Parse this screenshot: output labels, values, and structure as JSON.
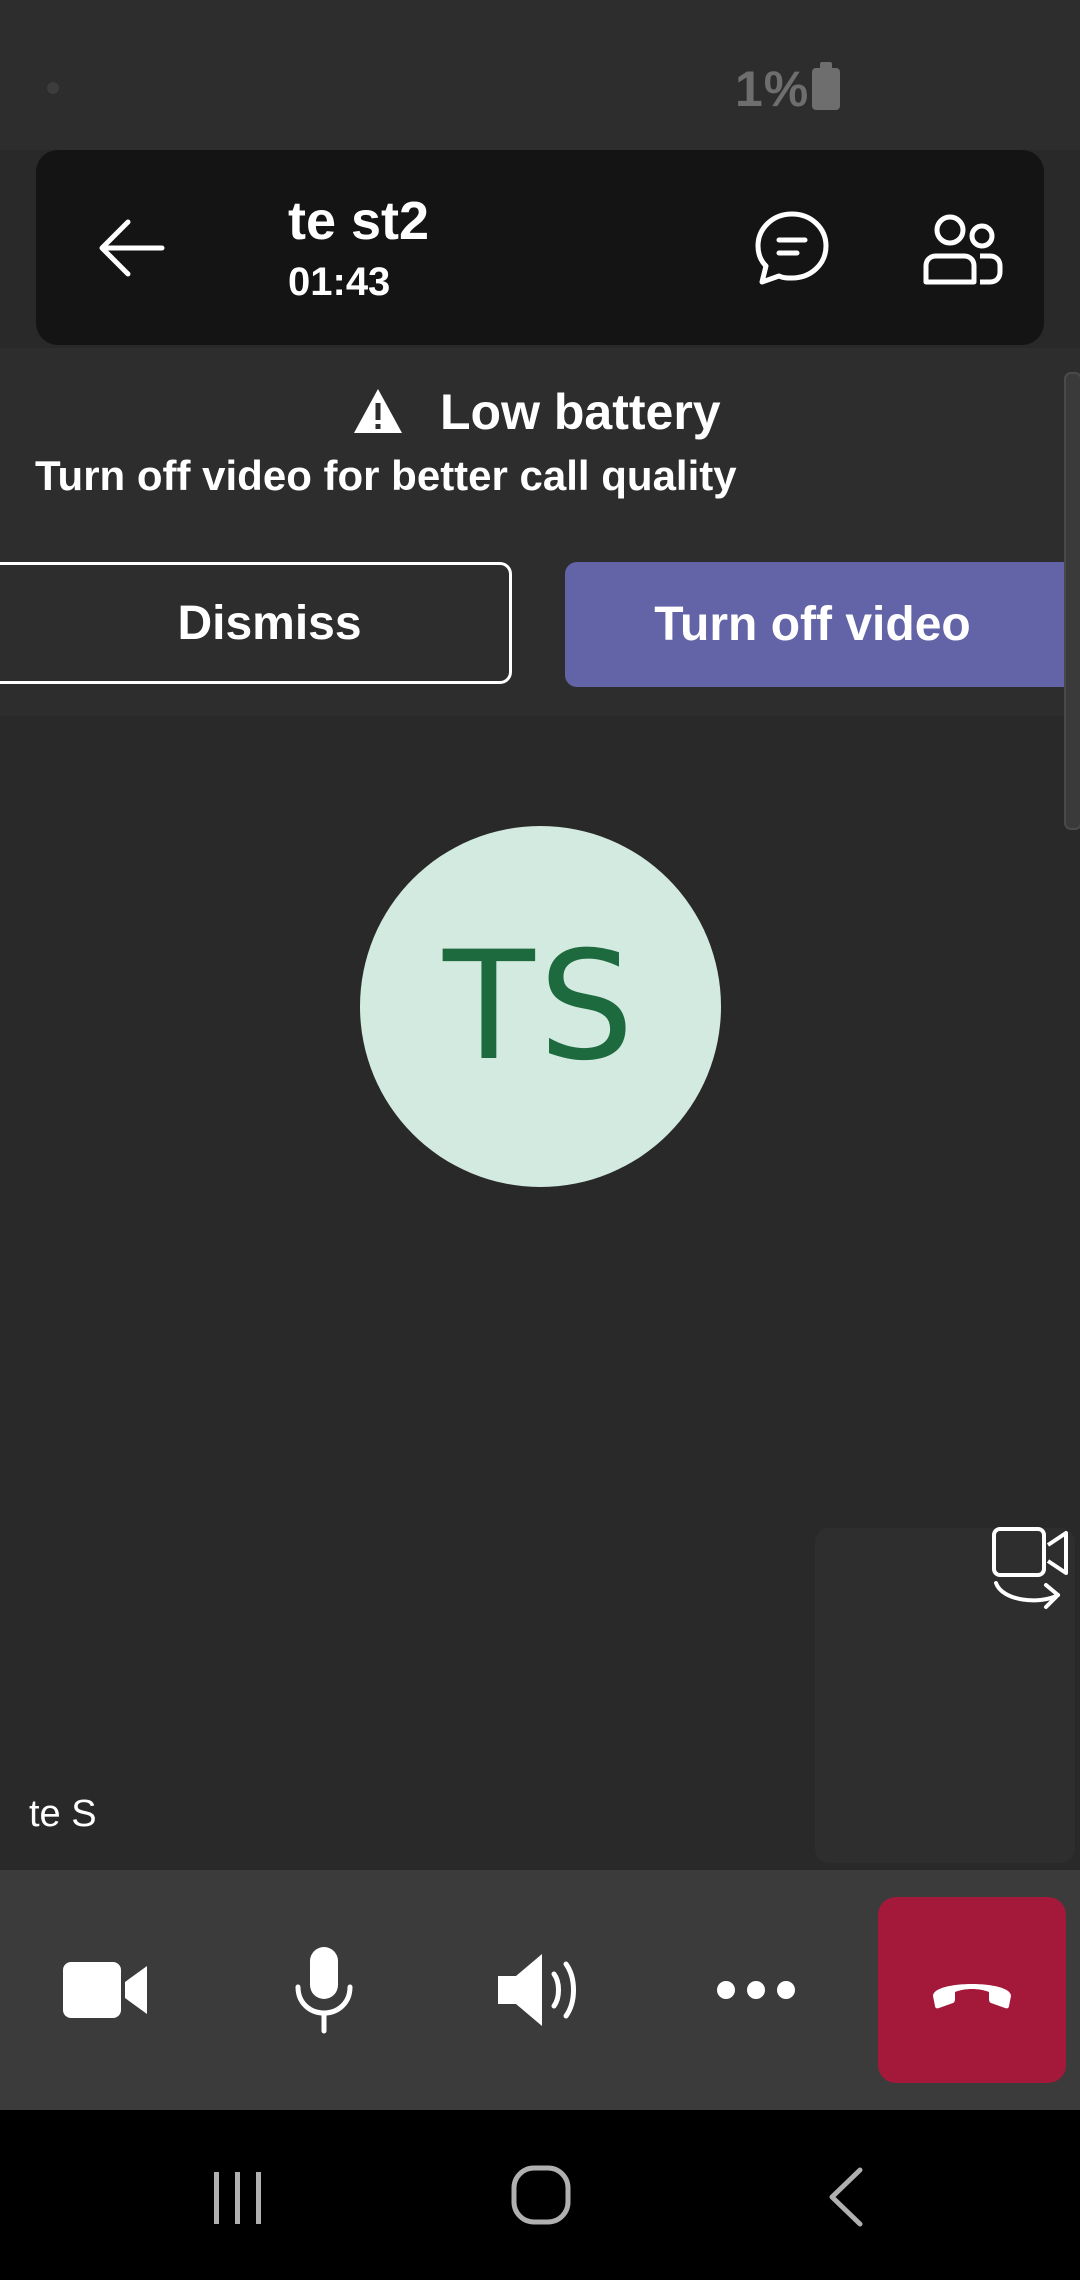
{
  "status_bar": {
    "battery_percent": "1%"
  },
  "header": {
    "title": "te st2",
    "call_duration": "01:43",
    "back_icon": "arrow-left-icon",
    "chat_icon": "chat-icon",
    "people_icon": "people-icon"
  },
  "banner": {
    "title": "Low battery",
    "subtitle": "Turn off video for better call quality",
    "dismiss_label": "Dismiss",
    "turn_off_label": "Turn off video",
    "warning_icon": "warning-icon",
    "accent_color": "#6264a7"
  },
  "participant": {
    "initials": "TS",
    "name": "te S",
    "avatar_bg": "#d2eadf",
    "avatar_fg": "#1d6a3e"
  },
  "controls": {
    "camera_icon": "video-camera-icon",
    "mic_icon": "microphone-icon",
    "speaker_icon": "speaker-icon",
    "more_icon": "more-icon",
    "end_call_icon": "hang-up-icon",
    "end_call_color": "#a4193a"
  },
  "nav": {
    "recent_icon": "recent-apps-icon",
    "home_icon": "home-icon",
    "back_icon": "back-icon"
  }
}
